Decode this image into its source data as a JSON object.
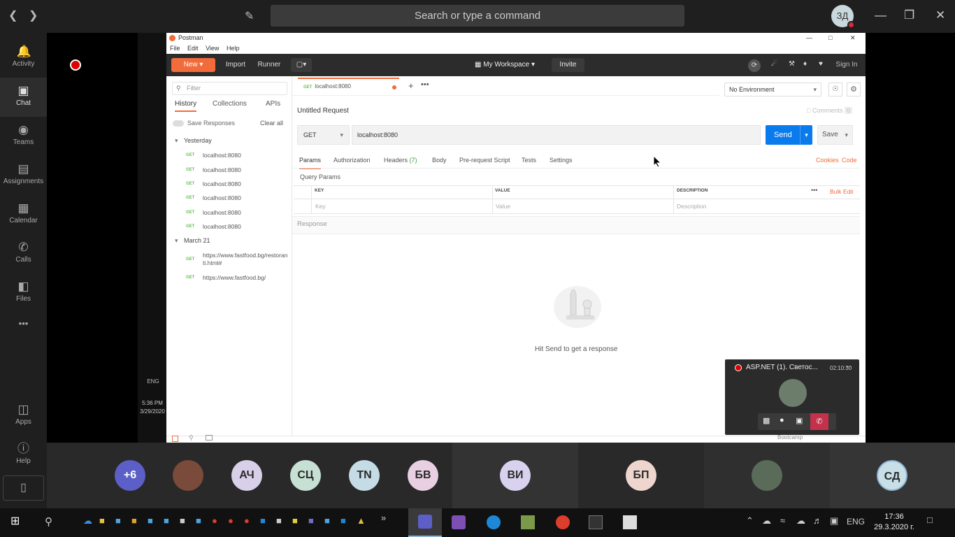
{
  "teams": {
    "search_placeholder": "Search or type a command",
    "me_initials": "ЗД",
    "rail": [
      {
        "label": "Activity",
        "icon": "bell-icon"
      },
      {
        "label": "Chat",
        "icon": "chat-icon"
      },
      {
        "label": "Teams",
        "icon": "teams-icon"
      },
      {
        "label": "Assignments",
        "icon": "backpack-icon"
      },
      {
        "label": "Calendar",
        "icon": "calendar-icon"
      },
      {
        "label": "Calls",
        "icon": "phone-icon"
      },
      {
        "label": "Files",
        "icon": "file-icon"
      },
      {
        "label": "Apps",
        "icon": "apps-icon"
      },
      {
        "label": "Help",
        "icon": "help-icon"
      }
    ],
    "more_label": "•••",
    "participants": [
      {
        "initials": "+6",
        "color": "#5b5fc7"
      },
      {
        "initials": "",
        "color": "#7a4a3a"
      },
      {
        "initials": "АЧ",
        "color": "#d8d0e8"
      },
      {
        "initials": "СЦ",
        "color": "#c7e0d4"
      },
      {
        "initials": "TN",
        "color": "#c5dbe6"
      },
      {
        "initials": "БВ",
        "color": "#e8cfe2"
      },
      {
        "initials": "ВИ",
        "color": "#d9d2ee"
      },
      {
        "initials": "БП",
        "color": "#eed6cf"
      },
      {
        "initials": "",
        "color": "#5a6b5a"
      },
      {
        "initials": "СД",
        "color": "#c9dfe8"
      }
    ]
  },
  "call": {
    "title": "ASP.NET (1). Светос...",
    "time": "02:10:30",
    "more": "..."
  },
  "taskbar_left": {
    "lang": "ENG",
    "time": "5:36 PM",
    "date": "3/29/2020"
  },
  "postman": {
    "window_title": "Postman",
    "menu": [
      "File",
      "Edit",
      "View",
      "Help"
    ],
    "header": {
      "new_label": "New",
      "import_label": "Import",
      "runner_label": "Runner",
      "workspace_label": "My Workspace",
      "invite_label": "Invite",
      "signin_label": "Sign In"
    },
    "sidebar": {
      "filter_placeholder": "Filter",
      "tabs": [
        "History",
        "Collections",
        "APIs"
      ],
      "save_responses": "Save Responses",
      "clear_all": "Clear all",
      "groups": [
        {
          "label": "Yesterday",
          "items": [
            {
              "method": "GET",
              "url": "localhost:8080"
            },
            {
              "method": "GET",
              "url": "localhost:8080"
            },
            {
              "method": "GET",
              "url": "localhost:8080"
            },
            {
              "method": "GET",
              "url": "localhost:8080"
            },
            {
              "method": "GET",
              "url": "localhost:8080"
            },
            {
              "method": "GET",
              "url": "localhost:8080"
            }
          ]
        },
        {
          "label": "March 21",
          "items": [
            {
              "method": "GET",
              "url": "https://www.fastfood.bg/restoranti.html#"
            },
            {
              "method": "GET",
              "url": "https://www.fastfood.bg/"
            }
          ]
        }
      ]
    },
    "tab": {
      "method": "GET",
      "label": "localhost:8080"
    },
    "environment": "No Environment",
    "request_name": "Untitled Request",
    "comments_label": "Comments",
    "comments_count": "0",
    "method": "GET",
    "url": "localhost:8080",
    "send_label": "Send",
    "save_label": "Save",
    "req_tabs": [
      "Params",
      "Authorization",
      "Headers",
      "Body",
      "Pre-request Script",
      "Tests",
      "Settings"
    ],
    "headers_count": "(7)",
    "cookies_label": "Cookies",
    "code_label": "Code",
    "query_params_label": "Query Params",
    "columns": [
      "KEY",
      "VALUE",
      "DESCRIPTION"
    ],
    "bulk_edit": "Bulk Edit",
    "placeholders": [
      "Key",
      "Value",
      "Description"
    ],
    "response_label": "Response",
    "empty_message": "Hit Send to get a response",
    "status_bar": "Bootcamp"
  },
  "windows": {
    "lang": "ENG",
    "time": "17:36",
    "date": "29.3.2020 г."
  }
}
